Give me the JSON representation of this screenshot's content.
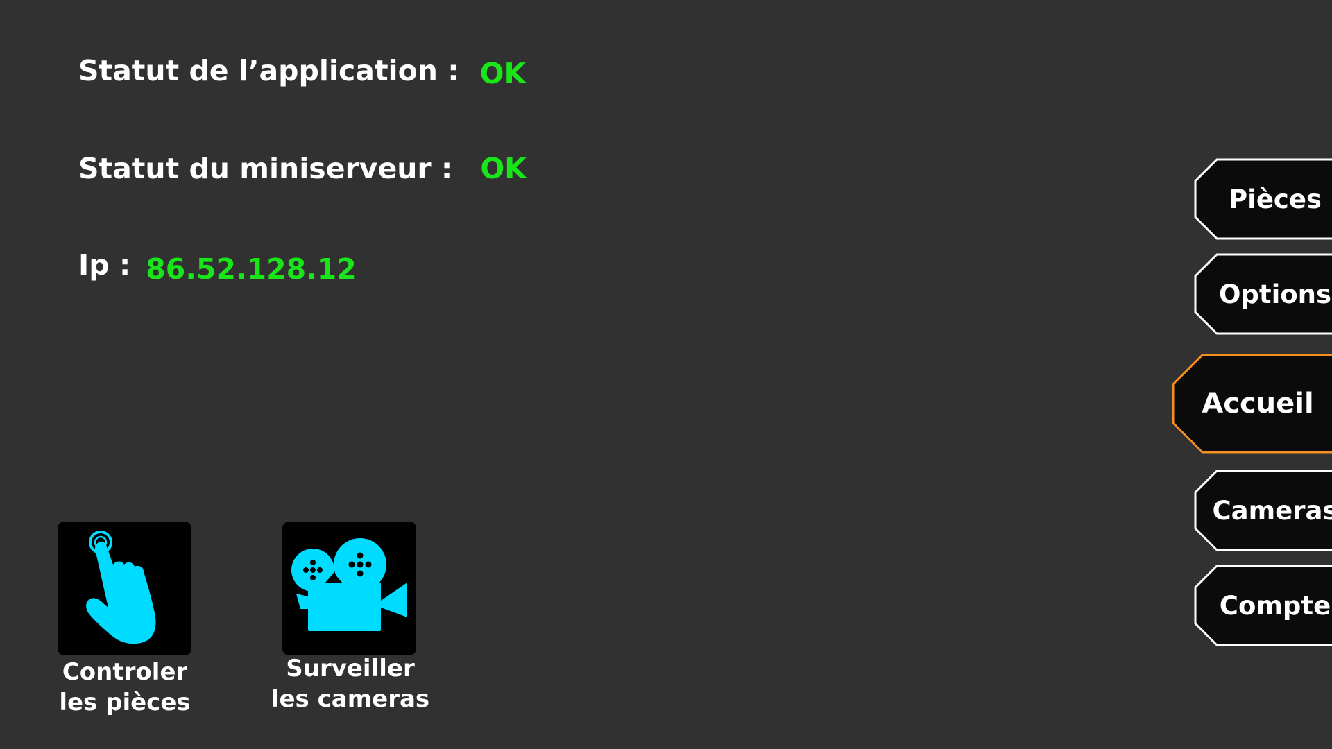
{
  "status": {
    "app_label": "Statut de l’application :",
    "app_value": "OK",
    "miniserver_label": "Statut du miniserveur :",
    "miniserver_value": "OK",
    "ip_label": "Ip :",
    "ip_value": "86.52.128.12"
  },
  "shortcuts": [
    {
      "icon": "touch-hand-icon",
      "line1": "Controler",
      "line2": "les pièces"
    },
    {
      "icon": "movie-camera-icon",
      "line1": "Surveiller",
      "line2": "les cameras"
    }
  ],
  "nav": {
    "items": [
      {
        "label": "Pièces",
        "active": false
      },
      {
        "label": "Options",
        "active": false
      },
      {
        "label": "Accueil",
        "active": true
      },
      {
        "label": "Cameras",
        "active": false
      },
      {
        "label": "Compte",
        "active": false
      }
    ]
  },
  "colors": {
    "background": "#313131",
    "ok_green": "#19e619",
    "icon_cyan": "#00dcff",
    "active_border": "#f5901e",
    "button_border": "#ffffff"
  }
}
